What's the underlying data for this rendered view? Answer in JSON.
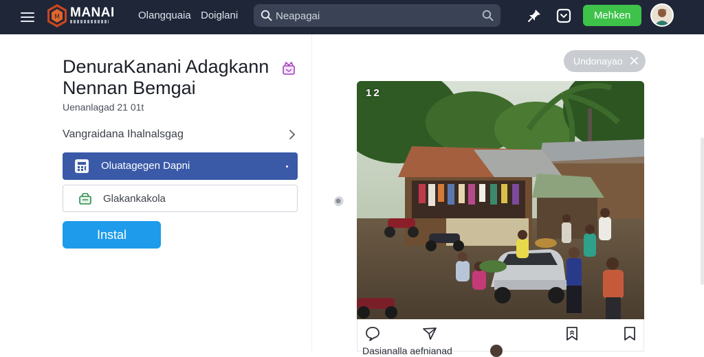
{
  "header": {
    "brand": "MANAI",
    "nav": [
      "Olangquaia",
      "Doiglani"
    ],
    "search_placeholder": "Neapagai",
    "cta_label": "Mehken",
    "icons": [
      "menu-icon",
      "logo-emblem",
      "search-icon",
      "pin-icon",
      "square-icon",
      "avatar"
    ]
  },
  "main": {
    "title_line1": "DenuraKanani Adagkann",
    "title_line2": "Nennan Bemgai",
    "subtitle": "Uenanlagad​ 21 01​t",
    "link_label": "Vangraidana Ihalnalsgag",
    "option_selected": "Oluatagegen Dapni",
    "option_plain": "Glakankakola",
    "install_label": "Instal"
  },
  "card": {
    "chip_label": "Undonayao",
    "photo_count": "1 2",
    "caption": "Dasianalla aefnianad",
    "colors": {
      "accent_green": "#3ec24a",
      "accent_blue": "#1e9bea",
      "selected_blue": "#3a5aa8"
    }
  }
}
